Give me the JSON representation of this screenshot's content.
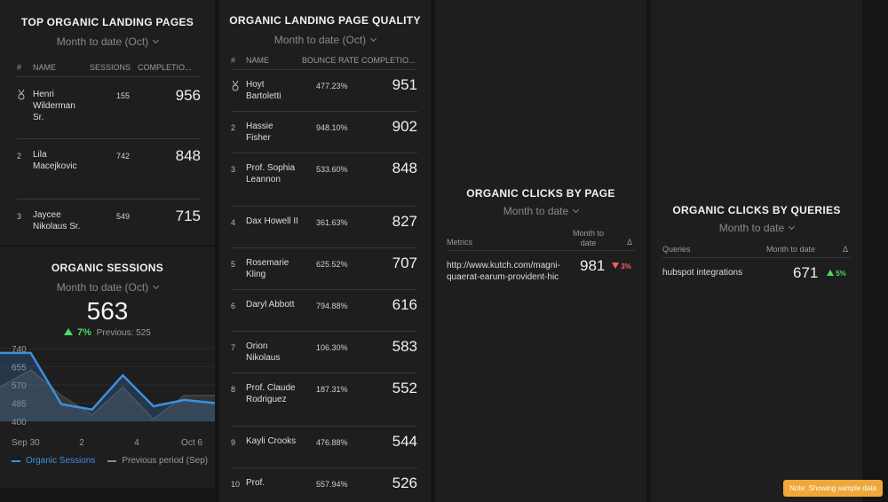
{
  "panels": {
    "landing": {
      "title": "TOP ORGANIC LANDING PAGES",
      "period": "Month to date (Oct)",
      "headers": [
        "#",
        "NAME",
        "SESSIONS",
        "COMPLETIO..."
      ],
      "rows": [
        {
          "rank": "",
          "name": "Henri Wilderman Sr.",
          "sessions": "155",
          "completions": "956"
        },
        {
          "rank": "2",
          "name": "Lila Macejkovic",
          "sessions": "742",
          "completions": "848"
        },
        {
          "rank": "3",
          "name": "Jaycee Nikolaus Sr.",
          "sessions": "549",
          "completions": "715"
        }
      ]
    },
    "sessions": {
      "title": "ORGANIC SESSIONS",
      "period": "Month to date (Oct)",
      "value": "563",
      "delta": "7%",
      "previous": "Previous: 525",
      "legend_current": "Organic Sessions",
      "legend_previous": "Previous period (Sep)"
    },
    "quality": {
      "title": "ORGANIC LANDING PAGE QUALITY",
      "period": "Month to date (Oct)",
      "headers": [
        "#",
        "NAME",
        "BOUNCE RATE",
        "COMPLETIO..."
      ],
      "rows": [
        {
          "rank": "",
          "name": "Hoyt Bartoletti",
          "bounce": "477.23%",
          "completions": "951"
        },
        {
          "rank": "2",
          "name": "Hassie Fisher",
          "bounce": "948.10%",
          "completions": "902"
        },
        {
          "rank": "3",
          "name": "Prof. Sophia Leannon",
          "bounce": "533.60%",
          "completions": "848"
        },
        {
          "rank": "4",
          "name": "Dax Howell II",
          "bounce": "361.63%",
          "completions": "827"
        },
        {
          "rank": "5",
          "name": "Rosemarie Kling",
          "bounce": "625.52%",
          "completions": "707"
        },
        {
          "rank": "6",
          "name": "Daryl Abbott",
          "bounce": "794.88%",
          "completions": "616"
        },
        {
          "rank": "7",
          "name": "Orion Nikolaus",
          "bounce": "106.30%",
          "completions": "583"
        },
        {
          "rank": "8",
          "name": "Prof. Claude Rodriguez",
          "bounce": "187.31%",
          "completions": "552"
        },
        {
          "rank": "9",
          "name": "Kayli Crooks",
          "bounce": "476.88%",
          "completions": "544"
        },
        {
          "rank": "10",
          "name": "Prof.",
          "bounce": "557.94%",
          "completions": "526"
        }
      ]
    },
    "clicks_page": {
      "title": "ORGANIC CLICKS BY PAGE",
      "period": "Month to date",
      "col_metrics": "Metrics",
      "col_month": "Month to date",
      "col_delta": "Δ",
      "url": "http://www.kutch.com/magni-quaerat-earum-provident-hic",
      "value": "981",
      "delta": "3%"
    },
    "clicks_queries": {
      "title": "ORGANIC CLICKS BY QUERIES",
      "period": "Month to date",
      "col_queries": "Queries",
      "col_month": "Month to date",
      "col_delta": "Δ",
      "query": "hubspot integrations",
      "value": "671",
      "delta": "5%"
    }
  },
  "note": "Note: Showing sample data",
  "colors": {
    "current": "#3d8fe0",
    "previous": "#5a5a5a",
    "up": "#4cd964",
    "down": "#ff5e5e"
  },
  "chart_data": {
    "type": "line",
    "x": [
      "Sep 30",
      "Oct 1",
      "Oct 2",
      "Oct 3",
      "Oct 4",
      "Oct 5",
      "Oct 6",
      "Oct 7"
    ],
    "xticks": [
      "Sep 30",
      "2",
      "4",
      "Oct 6"
    ],
    "yticks": [
      "740",
      "655",
      "570",
      "485",
      "400"
    ],
    "ylim": [
      400,
      740
    ],
    "series": [
      {
        "name": "Organic Sessions",
        "values": [
          720,
          720,
          480,
          455,
          615,
          470,
          500,
          485
        ]
      },
      {
        "name": "Previous period (Sep)",
        "values": [
          560,
          640,
          520,
          430,
          560,
          410,
          520,
          520
        ]
      }
    ]
  }
}
